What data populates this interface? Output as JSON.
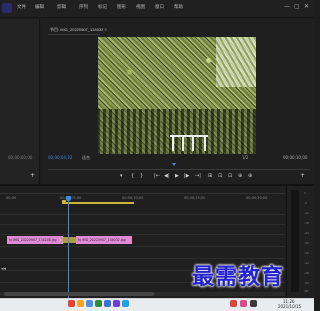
{
  "menu": {
    "items": [
      "文件",
      "编辑",
      "剪辑",
      "序列",
      "标记",
      "图形",
      "视图",
      "窗口",
      "帮助"
    ],
    "window_controls": [
      "—",
      "▢",
      "✕"
    ]
  },
  "program_monitor": {
    "title": "节目: IMG_20220907_134032 ≡",
    "tc_left": "00;00;00;00",
    "tc_current": "00;00;04;22",
    "fit": "适合",
    "quality": "1/2",
    "tc_duration": "00;00;10;00"
  },
  "transport": {
    "buttons": [
      "▾",
      "{",
      "}",
      "|←",
      "◀|",
      "▶",
      "|▶",
      "→|",
      "⊞",
      "⊡",
      "⊡",
      "⊕",
      "⊕",
      "+"
    ]
  },
  "timeline": {
    "ruler": [
      "00;00",
      "00;00;05;00",
      "00;00;10;00",
      "00;00;15;00",
      "00;00;20;00"
    ],
    "clips": [
      {
        "label": "fx IMG_20220907_134208.jpg"
      },
      {
        "label": "fx IMG_20220907_134032.jpg"
      }
    ],
    "track_arrows": "◂◂",
    "meter_scale": [
      "0",
      "-6",
      "-12",
      "-18",
      "-24",
      "-30",
      "-36",
      "-42",
      "-48",
      "-54",
      "dB"
    ]
  },
  "watermark": "最需教育",
  "taskbar": {
    "time": "11:26",
    "date": "2021/10/15",
    "icon_colors": [
      "#e0433a",
      "#f4a52a",
      "#4a90e2",
      "#2c8a3a",
      "#3b6fd8",
      "#6a3bd8",
      "#1fa3e0",
      "#e0433a",
      "#d84a8a",
      "#3a3a3a"
    ]
  },
  "accent": "#3b8ae6",
  "clip_color": "#e08ad6"
}
